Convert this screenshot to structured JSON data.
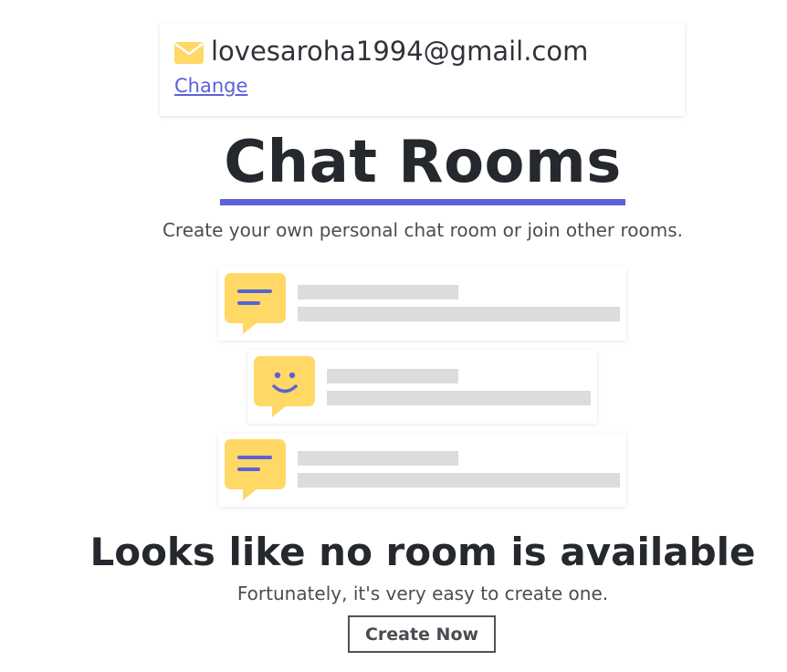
{
  "account": {
    "icon": "mail-icon",
    "email": "lovesaroha1994@gmail.com",
    "change_label": "Change"
  },
  "header": {
    "title": "Chat Rooms",
    "subtitle": "Create your own personal chat room or join other rooms."
  },
  "illustration": {
    "cards": [
      {
        "icon": "chat-lines-icon"
      },
      {
        "icon": "chat-smile-icon"
      },
      {
        "icon": "chat-lines-icon"
      }
    ]
  },
  "empty_state": {
    "heading": "Looks like no room is available",
    "subtext": "Fortunately, it's very easy to create one.",
    "button_label": "Create Now"
  },
  "colors": {
    "accent": "#5b62d6",
    "bubble": "#ffd866",
    "skeleton": "#dcdcdc",
    "text": "#25282d"
  }
}
